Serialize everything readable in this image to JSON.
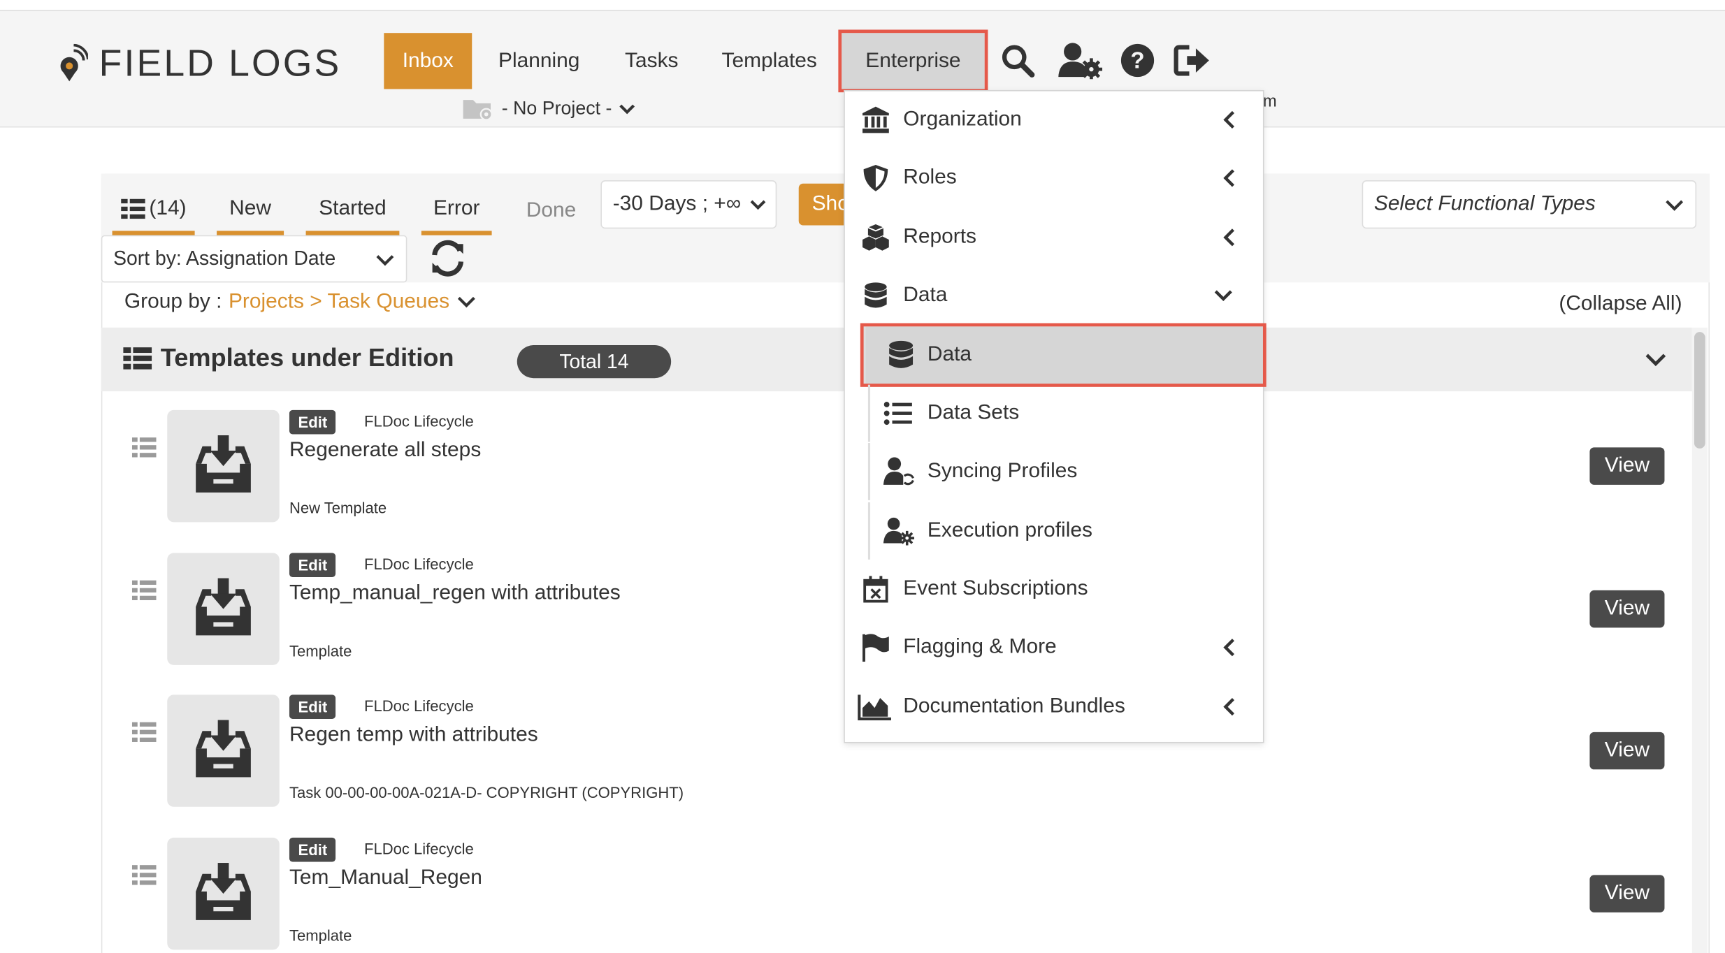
{
  "header": {
    "logo_text": "FIELD LOGS",
    "nav": {
      "inbox": "Inbox",
      "planning": "Planning",
      "tasks": "Tasks",
      "templates": "Templates",
      "enterprise": "Enterprise"
    },
    "project": "- No Project -",
    "partial_text": "m",
    "icons": [
      "search-icon",
      "user-settings-icon",
      "help-icon",
      "logout-icon"
    ],
    "accent_color": "#d9912f",
    "highlight_color": "#e5594a"
  },
  "filters": {
    "tabs": {
      "all_count": "(14)",
      "new": "New",
      "started": "Started",
      "error": "Error",
      "done": "Done"
    },
    "range": "-30 Days ; +∞",
    "show_button": "Sho",
    "functional_types_placeholder": "Select Functional Types",
    "sort_by": "Sort by: Assignation Date",
    "group_by_label": "Group by :",
    "group_by_value": "Projects > Task Queues",
    "collapse_all": "(Collapse All)"
  },
  "group": {
    "title": "Templates under Edition",
    "total": "Total 14"
  },
  "rows": [
    {
      "badge": "Edit",
      "lifecycle": "FLDoc Lifecycle",
      "title": "Regenerate all steps",
      "subtitle": "New Template",
      "action": "View"
    },
    {
      "badge": "Edit",
      "lifecycle": "FLDoc Lifecycle",
      "title": "Temp_manual_regen with attributes",
      "subtitle": "Template",
      "action": "View"
    },
    {
      "badge": "Edit",
      "lifecycle": "FLDoc Lifecycle",
      "title": "Regen temp with attributes",
      "subtitle": "Task 00-00-00-00A-021A-D- COPYRIGHT (COPYRIGHT)",
      "action": "View"
    },
    {
      "badge": "Edit",
      "lifecycle": "FLDoc Lifecycle",
      "title": "Tem_Manual_Regen",
      "subtitle": "Template",
      "action": "View"
    }
  ],
  "menu": {
    "organization": "Organization",
    "roles": "Roles",
    "reports": "Reports",
    "data": "Data",
    "data_sub": {
      "data": "Data",
      "data_sets": "Data Sets",
      "syncing_profiles": "Syncing Profiles",
      "execution_profiles": "Execution profiles"
    },
    "event_subscriptions": "Event Subscriptions",
    "flagging": "Flagging & More",
    "documentation_bundles": "Documentation Bundles"
  }
}
